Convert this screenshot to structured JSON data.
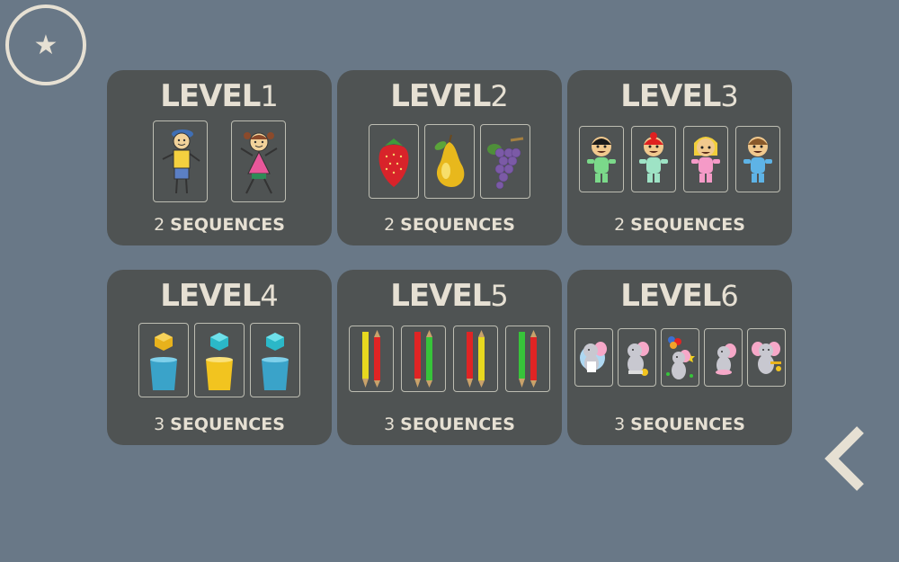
{
  "header": {
    "favorites_icon": "star-icon"
  },
  "navigation": {
    "back_icon": "chevron-left-icon"
  },
  "levels": [
    {
      "word": "LEVEL",
      "number": "1",
      "count": "2",
      "sequences_label": "SEQUENCES",
      "images": [
        "boy-icon",
        "girl-icon"
      ]
    },
    {
      "word": "LEVEL",
      "number": "2",
      "count": "2",
      "sequences_label": "SEQUENCES",
      "images": [
        "strawberry-icon",
        "pear-icon",
        "grapes-icon"
      ]
    },
    {
      "word": "LEVEL",
      "number": "3",
      "count": "2",
      "sequences_label": "SEQUENCES",
      "images": [
        "child-black-hair-icon",
        "child-red-hair-icon",
        "child-blonde-hair-icon",
        "child-brown-hair-icon"
      ]
    },
    {
      "word": "LEVEL",
      "number": "4",
      "count": "3",
      "sequences_label": "SEQUENCES",
      "images": [
        "cube-in-blue-cup-icon",
        "cube-in-yellow-cup-icon",
        "cube-in-blue-cup-icon"
      ]
    },
    {
      "word": "LEVEL",
      "number": "5",
      "count": "3",
      "sequences_label": "SEQUENCES",
      "images": [
        "pencils-yellow-red-icon",
        "pencils-red-green-icon",
        "pencils-red-yellow-icon",
        "pencils-green-red-icon"
      ]
    },
    {
      "word": "LEVEL",
      "number": "6",
      "count": "3",
      "sequences_label": "SEQUENCES",
      "images": [
        "elephant-icon",
        "elephant-icon",
        "elephant-balloons-icon",
        "elephant-moon-icon",
        "elephant-icon"
      ]
    }
  ],
  "colors": {
    "background": "#697887",
    "card": "#4f5353",
    "text": "#e6e0d3"
  }
}
